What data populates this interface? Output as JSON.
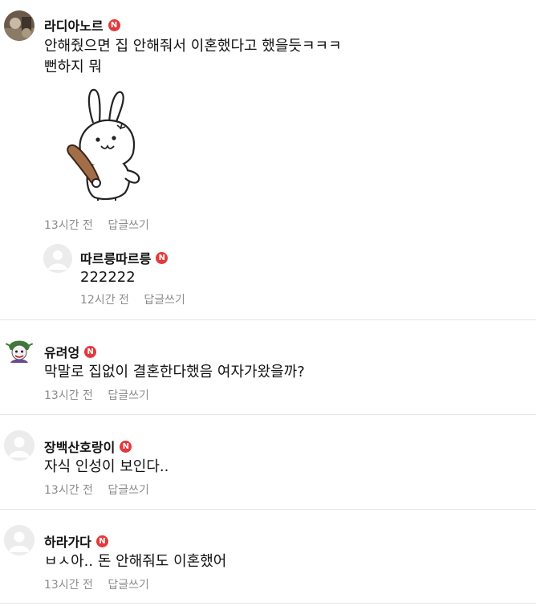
{
  "comments": [
    {
      "author": "라디아노르",
      "badge": "N",
      "lines": [
        "안해줬으면 집 안해줘서 이혼했다고 했을듯ㅋㅋㅋ",
        "뻔하지 뭐"
      ],
      "time": "13시간 전",
      "reply_label": "답글쓰기",
      "replies": [
        {
          "author": "따르릉따르릉",
          "badge": "N",
          "text": "222222",
          "time": "12시간 전",
          "reply_label": "답글쓰기"
        }
      ]
    },
    {
      "author": "유려엉",
      "badge": "N",
      "text": "막말로 집없이 결혼한다했음 여자가왔을까?",
      "time": "13시간 전",
      "reply_label": "답글쓰기"
    },
    {
      "author": "장백산호랑이",
      "badge": "N",
      "text": "자식 인성이 보인다..",
      "time": "13시간 전",
      "reply_label": "답글쓰기"
    },
    {
      "author": "하라가다",
      "badge": "N",
      "text": "ㅂㅅ아.. 돈 안해줘도 이혼했어",
      "time": "13시간 전",
      "reply_label": "답글쓰기"
    }
  ],
  "colors": {
    "badge": "#e5383b",
    "meta": "#8c8c8c",
    "divider": "#e6e6e6"
  }
}
